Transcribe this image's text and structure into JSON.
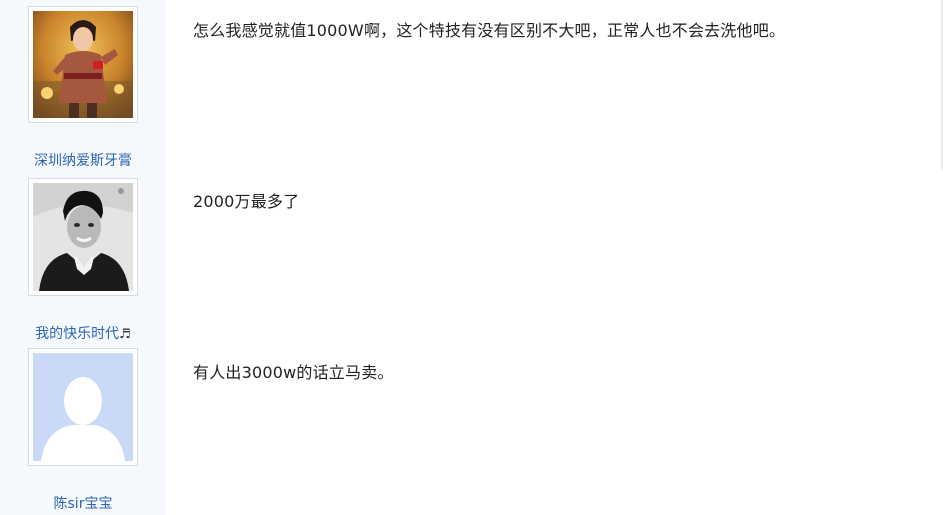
{
  "posts": [
    {
      "username": "深圳纳爱斯牙膏",
      "avatar": "stage-performer-photo",
      "text": "怎么我感觉就值1000W啊，这个特技有没有区别不大吧，正常人也不会去洗他吧。"
    },
    {
      "username": "我的快乐时代",
      "username_suffix": "♬",
      "avatar": "bw-portrait-photo",
      "text": "2000万最多了"
    },
    {
      "username": "陈sir宝宝",
      "avatar": "default-avatar-silhouette",
      "text": "有人出3000w的话立马卖。"
    }
  ],
  "colors": {
    "username": "#2d64b3",
    "sidebar_bg": "#f5f8fd",
    "default_avatar_bg": "#c9d9f7"
  }
}
